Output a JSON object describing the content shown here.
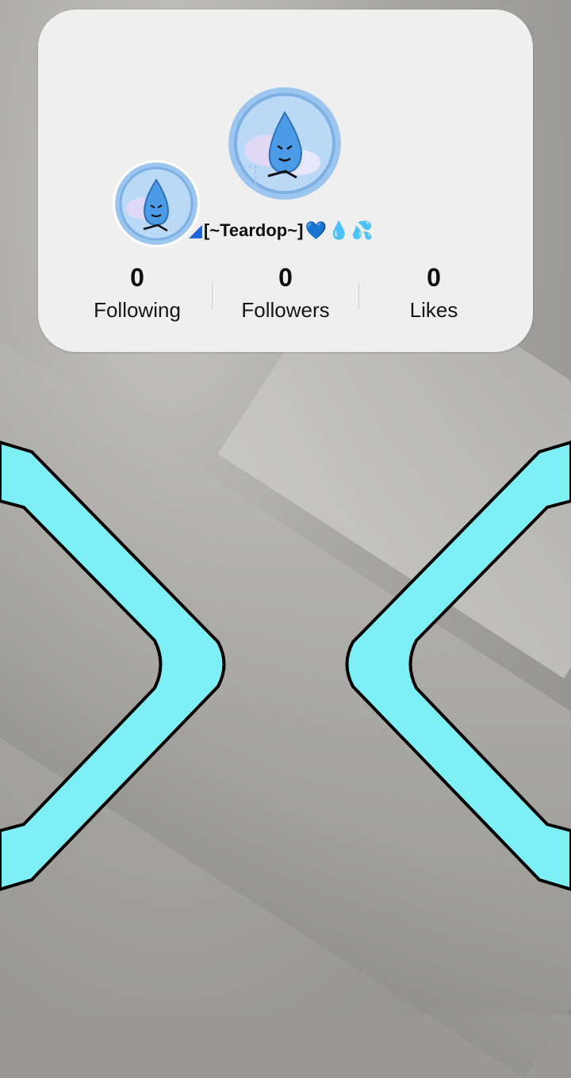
{
  "profile": {
    "username": "[~Teardop~]",
    "username_emojis": [
      "💙",
      "💧",
      "💦"
    ],
    "avatar_icon": "teardrop-character-icon"
  },
  "stats": [
    {
      "value": "0",
      "label": "Following"
    },
    {
      "value": "0",
      "label": "Followers"
    },
    {
      "value": "0",
      "label": "Likes"
    }
  ],
  "colors": {
    "card_bg": "#efefef",
    "frame_cyan": "#7ef0f5",
    "avatar_blue": "#6aa8e8"
  }
}
